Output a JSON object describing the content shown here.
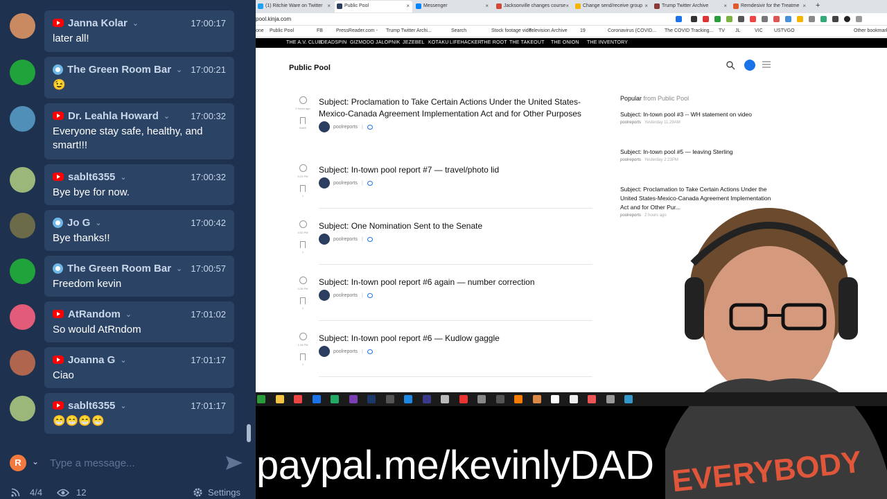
{
  "chat": {
    "messages": [
      {
        "source": "youtube",
        "user": "Janna Kolar",
        "time": "17:00:17",
        "text": "later all!",
        "avatar_color": "#c98a62"
      },
      {
        "source": "location",
        "user": "The Green Room Bar",
        "time": "17:00:21",
        "text": "😉",
        "avatar_color": "#1fa33a"
      },
      {
        "source": "youtube",
        "user": "Dr. Leahla Howard",
        "time": "17:00:32",
        "text": "Everyone stay safe, healthy, and smart!!!",
        "avatar_color": "#4f8fb8"
      },
      {
        "source": "youtube",
        "user": "sablt6355",
        "time": "17:00:32",
        "text": "Bye bye for now.",
        "avatar_color": "#9bb87a"
      },
      {
        "source": "location",
        "user": "Jo G",
        "time": "17:00:42",
        "text": "Bye thanks!!",
        "avatar_color": "#6b6b4a"
      },
      {
        "source": "location",
        "user": "The Green Room Bar",
        "time": "17:00:57",
        "text": "Freedom kevin",
        "avatar_color": "#1fa33a"
      },
      {
        "source": "youtube",
        "user": "AtRandom",
        "time": "17:01:02",
        "text": "So would AtRndom",
        "avatar_color": "#e25c7a"
      },
      {
        "source": "youtube",
        "user": "Joanna G",
        "time": "17:01:17",
        "text": "Ciao",
        "avatar_color": "#b0664e"
      },
      {
        "source": "youtube",
        "user": "sablt6355",
        "time": "17:01:17",
        "text": "😁😁😁😁",
        "avatar_color": "#9bb87a"
      }
    ],
    "composer": {
      "initial": "R",
      "placeholder": "Type a message..."
    },
    "footer": {
      "streams": "4/4",
      "viewers": "12",
      "settings": "Settings"
    }
  },
  "browser": {
    "tabs": [
      {
        "label": "(1) Ritchie Ware on Twitter",
        "icon_color": "#1da1f2"
      },
      {
        "label": "Public Pool",
        "icon_color": "#2c3e60",
        "active": true
      },
      {
        "label": "Messenger",
        "icon_color": "#0084ff"
      },
      {
        "label": "Jacksonville changes course",
        "icon_color": "#d04a3a"
      },
      {
        "label": "Change send/receive group",
        "icon_color": "#f4b400"
      },
      {
        "label": "Trump Twitter Archive",
        "icon_color": "#8b3a3a"
      },
      {
        "label": "Remdesivir for the Treatme",
        "icon_color": "#e05a2b"
      }
    ],
    "url": "pool.kinja.com",
    "bookmarks": [
      "one",
      "Public Pool",
      "FB",
      "PressReader.com -",
      "Trump Twitter Archi...",
      "Search",
      "Stock footage vide...",
      "Television Archive",
      "19",
      "Coronavirus (COVID...",
      "The COVID Tracking...",
      "TV",
      "JL",
      "VIC",
      "USTVGO",
      "Other bookmarks"
    ],
    "site_nav": [
      "THE A.V. CLUB",
      "DEADSPIN",
      "GIZMODO",
      "JALOPNIK",
      "JEZEBEL",
      "KOTAKU",
      "LIFEHACKER",
      "THE ROOT",
      "THE TAKEOUT",
      "THE ONION",
      "THE INVENTORY"
    ],
    "site_logo": "Public Pool",
    "posts": [
      {
        "title": "Subject: Proclamation to Take Certain Actions Under the United States-Mexico-Canada Agreement Implementation Act and for Other Purposes",
        "author": "poolreports",
        "ago": "2 hours ago",
        "saves": "SAVE"
      },
      {
        "title": "Subject: In-town pool report #7 — travel/photo lid",
        "author": "poolreports",
        "ago": "5:23 PM",
        "saves": "1"
      },
      {
        "title": "Subject: One Nomination Sent to the Senate",
        "author": "poolreports",
        "ago": "4:32 PM",
        "saves": "1"
      },
      {
        "title": "Subject: In-town pool report #6 again — number correction",
        "author": "poolreports",
        "ago": "4:28 PM",
        "saves": "1"
      },
      {
        "title": "Subject: In-town pool report #6 — Kudlow gaggle",
        "author": "poolreports",
        "ago": "1:18 PM",
        "saves": "1"
      }
    ],
    "popular": {
      "heading": "Popular",
      "from": "from Public Pool",
      "items": [
        {
          "title": "Subject: In-town pool #3 -- WH statement on video",
          "author": "poolreports",
          "date": "Yesterday 11:29AM"
        },
        {
          "title": "Subject: In-town pool #5 — leaving Sterling",
          "author": "poolreports",
          "date": "Yesterday 2:23PM"
        },
        {
          "title": "Subject: Proclamation to Take Certain Actions Under the United States-Mexico-Canada Agreement Implementation Act and for Other Pur...",
          "author": "poolreports",
          "date": "2 hours ago"
        }
      ]
    }
  },
  "overlay": {
    "text": "paypal.me/kevinlyDAD"
  },
  "colors": {
    "chat_bg": "#1e3250",
    "bubble": "#2b4365",
    "youtube": "#ff0000",
    "accent": "#1a73e8"
  }
}
